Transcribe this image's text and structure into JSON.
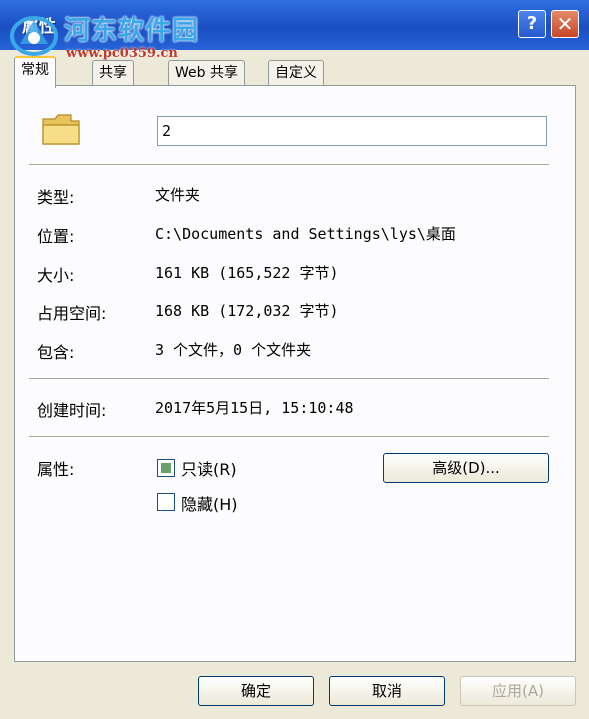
{
  "window": {
    "title": "属性"
  },
  "watermark": {
    "site_name": "河东软件园",
    "site_url": "www.pc0359.cn"
  },
  "title_buttons": {
    "help": "?",
    "close": "✕"
  },
  "tabs": [
    {
      "label": "常规",
      "active": true
    },
    {
      "label": "共享",
      "active": false
    },
    {
      "label": "Web 共享",
      "active": false
    },
    {
      "label": "自定义",
      "active": false
    }
  ],
  "general": {
    "folder_icon": "folder-icon",
    "name_value": "2",
    "type_label": "类型:",
    "type_value": "文件夹",
    "location_label": "位置:",
    "location_value": "C:\\Documents and Settings\\lys\\桌面",
    "size_label": "大小:",
    "size_value": "161 KB (165,522 字节)",
    "size_on_disk_label": "占用空间:",
    "size_on_disk_value": "168 KB (172,032 字节)",
    "contains_label": "包含:",
    "contains_value": "3 个文件，0 个文件夹",
    "created_label": "创建时间:",
    "created_value": "2017年5月15日, 15:10:48",
    "attributes_label": "属性:",
    "readonly_label": "只读(R)",
    "readonly_checked": true,
    "hidden_label": "隐藏(H)",
    "hidden_checked": false,
    "advanced_button": "高级(D)..."
  },
  "footer": {
    "ok": "确定",
    "cancel": "取消",
    "apply": "应用(A)"
  },
  "colors": {
    "titlebar": "#1a4fc2",
    "panel": "#fcfcfe",
    "dialog_bg": "#ece9d8",
    "active_tab_accent": "#ffc83c"
  }
}
